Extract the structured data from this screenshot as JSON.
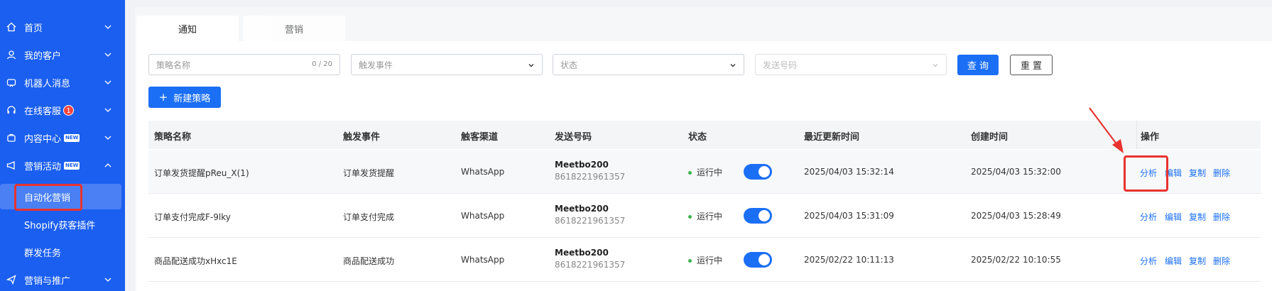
{
  "sidebar": {
    "items": [
      {
        "label": "首页",
        "icon": "home-icon"
      },
      {
        "label": "我的客户",
        "icon": "user-icon"
      },
      {
        "label": "机器人消息",
        "icon": "robot-icon"
      },
      {
        "label": "在线客服",
        "icon": "headset-icon",
        "badge": "1"
      },
      {
        "label": "内容中心",
        "icon": "content-icon",
        "tag": "NEW"
      },
      {
        "label": "营销活动",
        "icon": "megaphone-icon",
        "tag": "NEW"
      },
      {
        "label": "营销与推广",
        "icon": "promote-icon"
      }
    ],
    "sub_items": [
      {
        "label": "自动化营销"
      },
      {
        "label": "Shopify获客插件"
      },
      {
        "label": "群发任务"
      }
    ]
  },
  "tabs": [
    {
      "label": "通知"
    },
    {
      "label": "营销"
    }
  ],
  "filters": {
    "name_placeholder": "策略名称",
    "name_count": "0 / 20",
    "event_placeholder": "触发事件",
    "status_placeholder": "状态",
    "phone_placeholder": "发送号码",
    "query_label": "查 询",
    "reset_label": "重 置"
  },
  "new_strategy_label": "新建策略",
  "table": {
    "headers": [
      "策略名称",
      "触发事件",
      "触客渠道",
      "发送号码",
      "状态",
      "最近更新时间",
      "创建时间",
      "操作"
    ],
    "rows": [
      {
        "name": "订单发货提醒pReu_X(1)",
        "event": "订单发货提醒",
        "channel": "WhatsApp",
        "phone_name": "Meetbo200",
        "phone": "8618221961357",
        "status": "运行中",
        "enabled": true,
        "updated": "2025/04/03 15:32:14",
        "created": "2025/04/03 15:32:00"
      },
      {
        "name": "订单支付完成F-9lky",
        "event": "订单支付完成",
        "channel": "WhatsApp",
        "phone_name": "Meetbo200",
        "phone": "8618221961357",
        "status": "运行中",
        "enabled": true,
        "updated": "2025/04/03 15:31:09",
        "created": "2025/04/03 15:28:49"
      },
      {
        "name": "商品配送成功xHxc1E",
        "event": "商品配送成功",
        "channel": "WhatsApp",
        "phone_name": "Meetbo200",
        "phone": "8618221961357",
        "status": "运行中",
        "enabled": true,
        "updated": "2025/02/22 10:11:13",
        "created": "2025/02/22 10:10:55"
      }
    ],
    "actions": [
      "分析",
      "编辑",
      "复制",
      "删除"
    ]
  },
  "colors": {
    "sidebar": "#1b5ff0",
    "primary": "#1b6ff5",
    "annotation": "#e8332e",
    "status_dot": "#3bb54a"
  }
}
